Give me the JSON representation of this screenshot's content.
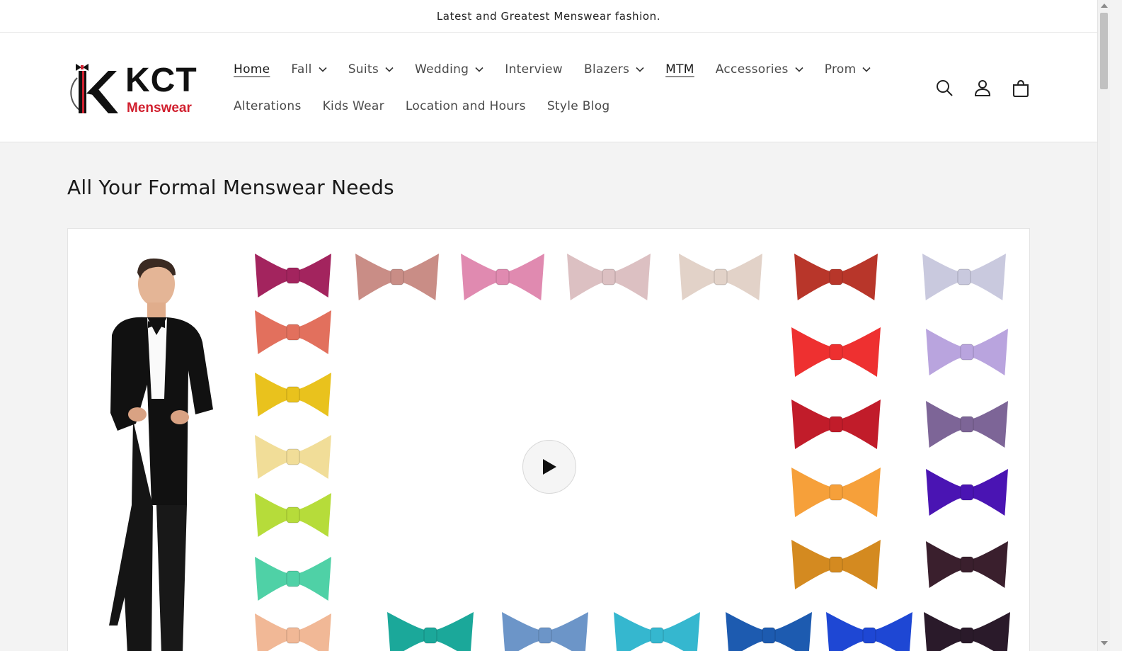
{
  "announcement": "Latest and Greatest Menswear fashion.",
  "logo": {
    "brand": "KCT",
    "sub": "Menswear"
  },
  "nav": {
    "row1": [
      {
        "label": "Home",
        "dropdown": false,
        "underline": true
      },
      {
        "label": "Fall",
        "dropdown": true,
        "underline": false
      },
      {
        "label": "Suits",
        "dropdown": true,
        "underline": false
      },
      {
        "label": "Wedding",
        "dropdown": true,
        "underline": false
      },
      {
        "label": "Interview",
        "dropdown": false,
        "underline": false
      },
      {
        "label": "Blazers",
        "dropdown": true,
        "underline": false
      },
      {
        "label": "MTM",
        "dropdown": false,
        "underline": true
      },
      {
        "label": "Accessories",
        "dropdown": true,
        "underline": false
      },
      {
        "label": "Prom",
        "dropdown": true,
        "underline": false
      }
    ],
    "row2": [
      {
        "label": "Alterations",
        "dropdown": false,
        "underline": false
      },
      {
        "label": "Kids Wear",
        "dropdown": false,
        "underline": false
      },
      {
        "label": "Location and Hours",
        "dropdown": false,
        "underline": false
      },
      {
        "label": "Style Blog",
        "dropdown": false,
        "underline": false
      }
    ]
  },
  "header_icons": [
    "search-icon",
    "account-icon",
    "cart-icon"
  ],
  "section": {
    "title": "All Your Formal Menswear Needs"
  },
  "colors": {
    "brand_red": "#d1202f",
    "bowties_left": [
      "#a3245e",
      "#e2705d",
      "#e9c21d",
      "#f1dd98",
      "#b6dc3a",
      "#4fd1a6",
      "#f1b896"
    ],
    "bowties_top": [
      "#c98d86",
      "#e08ab0",
      "#dcc0c2",
      "#e2d2c8",
      "#b8362a",
      "#c9c9de"
    ],
    "bowties_col_a": [
      "#ee3030",
      "#c11c2a",
      "#f6a03a",
      "#d48a20"
    ],
    "bowties_col_b": [
      "#b9a4de",
      "#7d6597",
      "#4a14b3",
      "#3a1f2d"
    ],
    "bowties_bottom": [
      "#1ba89a",
      "#6c95c8",
      "#35b7cf",
      "#1d5bb0",
      "#1e47d4",
      "#2a1a2a"
    ]
  }
}
